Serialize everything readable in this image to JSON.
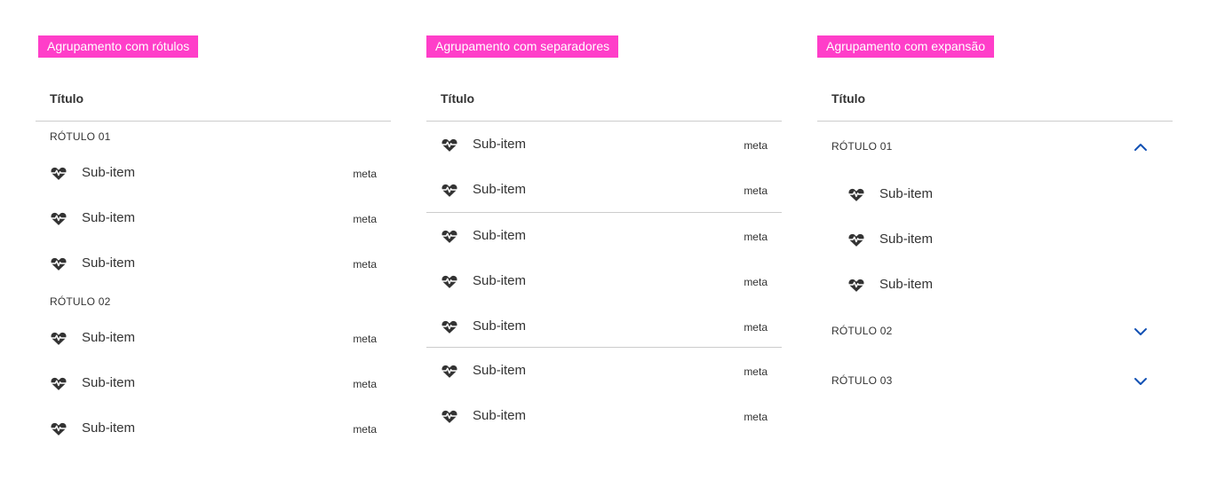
{
  "panels": [
    {
      "tag": "Agrupamento com rótulos",
      "title": "Título",
      "groups": [
        {
          "label": "RÓTULO 01",
          "items": [
            {
              "label": "Sub-item",
              "meta": "meta",
              "icon": "heartbeat-icon"
            },
            {
              "label": "Sub-item",
              "meta": "meta",
              "icon": "heartbeat-icon"
            },
            {
              "label": "Sub-item",
              "meta": "meta",
              "icon": "heartbeat-icon"
            }
          ]
        },
        {
          "label": "RÓTULO 02",
          "items": [
            {
              "label": "Sub-item",
              "meta": "meta",
              "icon": "heartbeat-icon"
            },
            {
              "label": "Sub-item",
              "meta": "meta",
              "icon": "heartbeat-icon"
            },
            {
              "label": "Sub-item",
              "meta": "meta",
              "icon": "heartbeat-icon"
            }
          ]
        }
      ]
    },
    {
      "tag": "Agrupamento com separadores",
      "title": "Título",
      "items": [
        {
          "label": "Sub-item",
          "meta": "meta",
          "icon": "heartbeat-icon"
        },
        {
          "label": "Sub-item",
          "meta": "meta",
          "icon": "heartbeat-icon"
        },
        {
          "label": "Sub-item",
          "meta": "meta",
          "icon": "heartbeat-icon"
        },
        {
          "label": "Sub-item",
          "meta": "meta",
          "icon": "heartbeat-icon"
        },
        {
          "label": "Sub-item",
          "meta": "meta",
          "icon": "heartbeat-icon"
        },
        {
          "label": "Sub-item",
          "meta": "meta",
          "icon": "heartbeat-icon"
        },
        {
          "label": "Sub-item",
          "meta": "meta",
          "icon": "heartbeat-icon"
        }
      ]
    },
    {
      "tag": "Agrupamento com expansão",
      "title": "Título",
      "groups": [
        {
          "label": "RÓTULO 01",
          "expanded": true,
          "chevron": "chevron-up-icon",
          "items": [
            {
              "label": "Sub-item",
              "icon": "heartbeat-icon"
            },
            {
              "label": "Sub-item",
              "icon": "heartbeat-icon"
            },
            {
              "label": "Sub-item",
              "icon": "heartbeat-icon"
            }
          ]
        },
        {
          "label": "RÓTULO 02",
          "expanded": false,
          "chevron": "chevron-down-icon"
        },
        {
          "label": "RÓTULO 03",
          "expanded": false,
          "chevron": "chevron-down-icon"
        }
      ]
    }
  ],
  "colors": {
    "tag_background": "#ff3ec9",
    "tag_text": "#ffffff",
    "text": "#333333",
    "divider": "#cccccc",
    "chevron": "#1351b4"
  }
}
